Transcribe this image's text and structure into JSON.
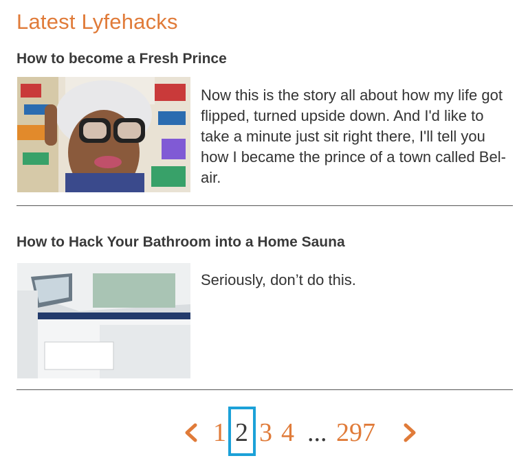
{
  "section": {
    "title": "Latest Lyfehacks"
  },
  "articles": [
    {
      "title": "How to become a Fresh Prince",
      "excerpt": "Now this is the story all about how my life got flipped, turned upside down. And I'd like to take a minute just sit right there, I'll tell you how I became the prince of a town called Bel-air.",
      "image": "person-with-glasses-photo"
    },
    {
      "title": "How to Hack Your Bathroom into a Home Sauna",
      "excerpt": "Seriously, don’t do this.",
      "image": "bathroom-renovation-photo"
    }
  ],
  "pagination": {
    "prev_icon": "chevron-left-icon",
    "next_icon": "chevron-right-icon",
    "pages": [
      "1",
      "2",
      "3",
      "4",
      "...",
      "297"
    ],
    "current": "2",
    "accent": "#e07b39",
    "highlight": "#1ba1d8"
  }
}
